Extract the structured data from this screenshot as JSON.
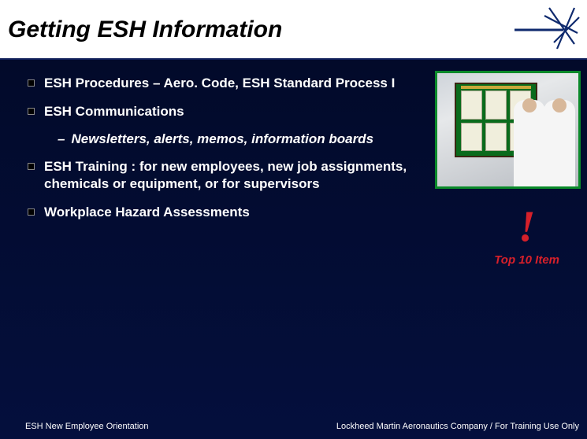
{
  "header": {
    "title": "Getting ESH Information"
  },
  "bullets": [
    {
      "text": "ESH Procedures – Aero. Code, ESH Standard Process I"
    },
    {
      "text": "ESH Communications",
      "sub": [
        {
          "text": "Newsletters, alerts, memos, information boards"
        }
      ]
    },
    {
      "text": "ESH Training : for new employees, new job assignments, chemicals or equipment, or for supervisors"
    },
    {
      "text": "Workplace Hazard Assessments"
    }
  ],
  "callout": {
    "mark": "!",
    "label": "Top 10 Item"
  },
  "footer": {
    "left": "ESH New Employee Orientation",
    "right": "Lockheed Martin Aeronautics Company / For Training Use Only"
  }
}
